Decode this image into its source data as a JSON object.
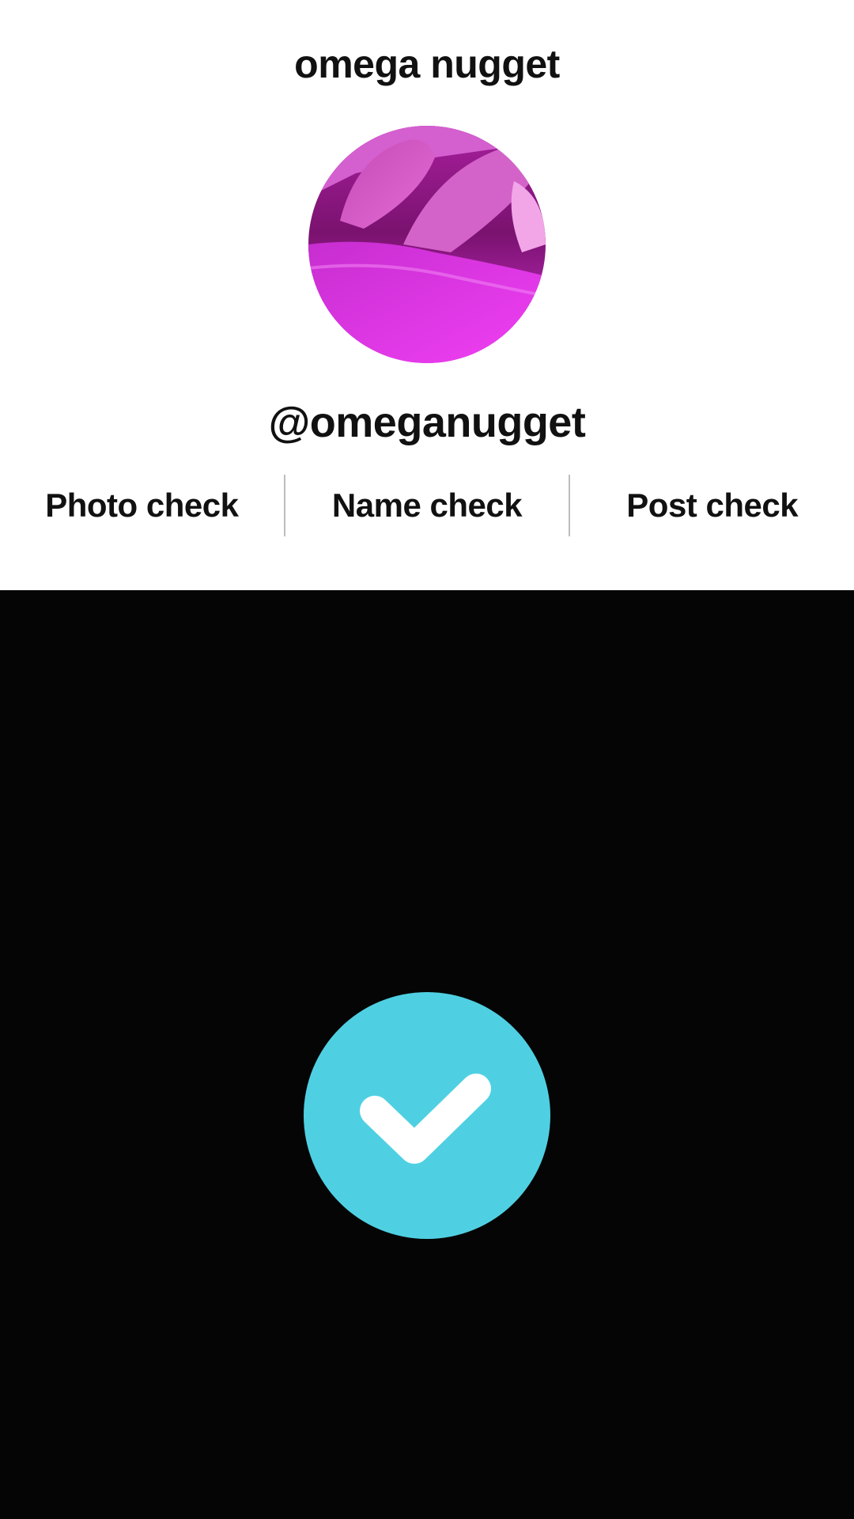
{
  "profile": {
    "display_name": "omega nugget",
    "username": "@omeganugget",
    "avatar": {
      "icon": "profile-photo",
      "dominant_color": "#e23de6"
    }
  },
  "checks": [
    {
      "label": "Photo check"
    },
    {
      "label": "Name check"
    },
    {
      "label": "Post check"
    }
  ],
  "overlay": {
    "status_icon": "checkmark-icon",
    "badge_color": "#4fd0e2",
    "background_color": "#050505"
  }
}
